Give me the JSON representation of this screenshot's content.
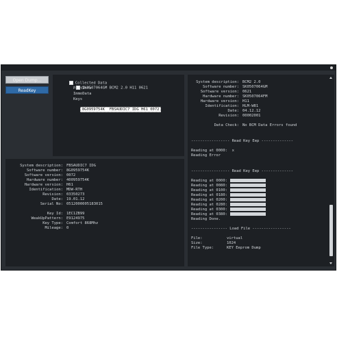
{
  "buttons": {
    "open_dump": "Open Dump...",
    "read_key": "ReadKey"
  },
  "tree": {
    "root": "Collected Data",
    "node": "SK0507064GM BCM2 2.0 H11 0621",
    "children": [
      "PartInfo",
      "ImmoData",
      "Keys"
    ],
    "selected": "8G0959754K  FBSAUDIC7 IDG H61 0072"
  },
  "key_info": {
    "rows": [
      {
        "label": "System description:",
        "value": "FBSAUDIC7 IDG"
      },
      {
        "label": "Software number:",
        "value": "8G0959754K"
      },
      {
        "label": "Software version:",
        "value": "0072"
      },
      {
        "label": "Hardware number:",
        "value": "400959754K"
      },
      {
        "label": "Hardware version:",
        "value": "H61"
      },
      {
        "label": "Identification:",
        "value": "MDW-RTH"
      },
      {
        "label": "Revision:",
        "value": "03350273"
      },
      {
        "label": "Date:",
        "value": "19.01.12"
      },
      {
        "label": "Serial No:",
        "value": "0512000005183015"
      }
    ],
    "rows2": [
      {
        "label": "Key Id:",
        "value": "1EC1ZB99"
      },
      {
        "label": "WeakUpPattern:",
        "value": "E9124975"
      },
      {
        "label": "Key Type:",
        "value": "Comfort 868Mhz"
      },
      {
        "label": "Mileage:",
        "value": "0"
      }
    ]
  },
  "bcm_info": {
    "rows": [
      {
        "label": "System description:",
        "value": "BCM2 2.0"
      },
      {
        "label": "Software number:",
        "value": "SK0507064GM"
      },
      {
        "label": "Software version:",
        "value": "0621"
      },
      {
        "label": "Hardware number:",
        "value": "SK0507064FM"
      },
      {
        "label": "Hardware version:",
        "value": "H11"
      },
      {
        "label": "Identification:",
        "value": "HLM-W81"
      },
      {
        "label": "Date:",
        "value": "04.12.12"
      },
      {
        "label": "Revision:",
        "value": "00002001"
      }
    ],
    "data_check_label": "Data Check:",
    "data_check_value": "No BCM Data Errors found"
  },
  "log": {
    "read_key_header": "----------------- Read Key Eep --------------",
    "read_key_lines": [
      "Reading at 0000:  x",
      "Reading Error"
    ],
    "read_key_header2": "----------------- Read Key Eep --------------",
    "reading_lines": [
      "Reading at 0000:",
      "Reading at 0080:",
      "Reading at 0100:",
      "Reading at 0180:",
      "Reading at 0200:",
      "Reading at 0280:",
      "Reading at 0300:",
      "Reading at 0380:"
    ],
    "reading_done": "Reading Done.",
    "load_file_header": "---------------- Load File -----------------",
    "file_rows": [
      {
        "label": "File:",
        "value": "virtual"
      },
      {
        "label": "Size:",
        "value": "1024"
      },
      {
        "label": "File Type:",
        "value": "KEY Eeprom Dump"
      }
    ]
  }
}
